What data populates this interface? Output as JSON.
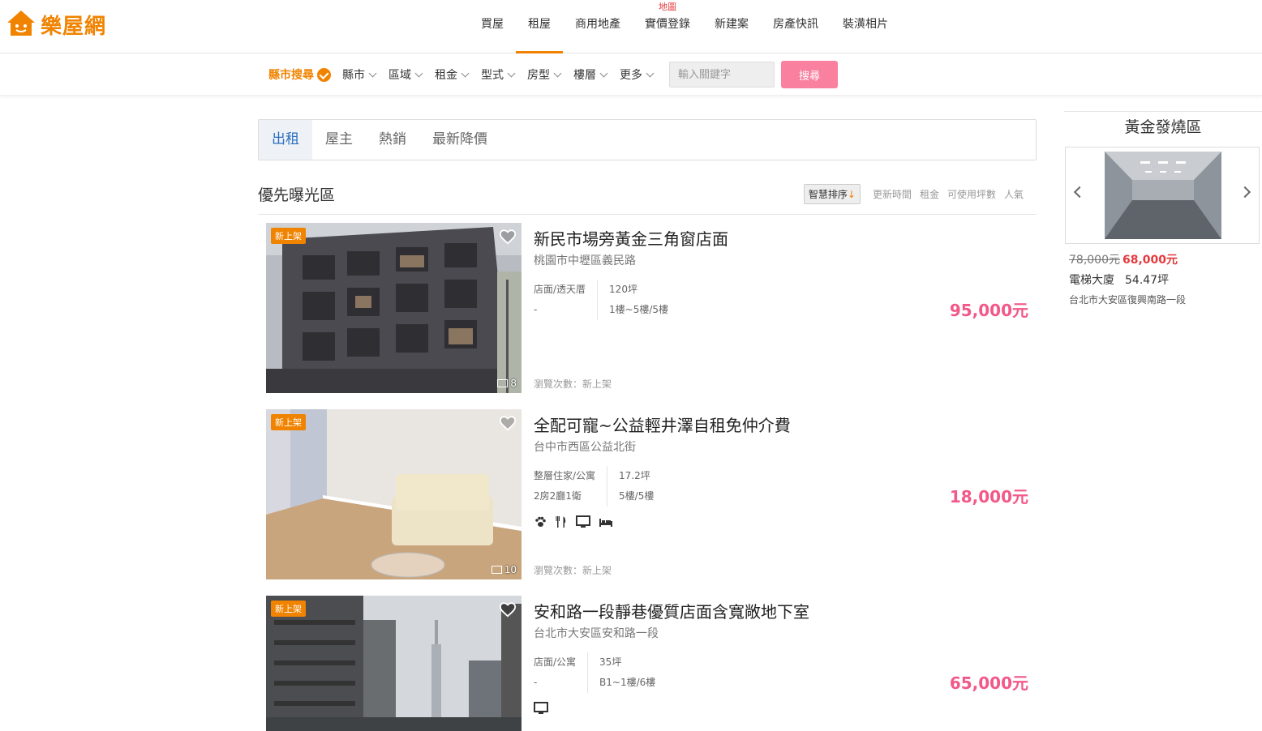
{
  "brand": {
    "name": "樂屋網",
    "color": "#f08300"
  },
  "nav": {
    "items": [
      {
        "label": "買屋"
      },
      {
        "label": "租屋",
        "active": true
      },
      {
        "label": "商用地產"
      },
      {
        "label": "實價登錄",
        "badge": "地圖"
      },
      {
        "label": "新建案"
      },
      {
        "label": "房產快訊"
      },
      {
        "label": "裝潢相片"
      }
    ]
  },
  "filters": {
    "city_search": "縣市搜尋",
    "dropdowns": [
      "縣市",
      "區域",
      "租金",
      "型式",
      "房型",
      "樓層",
      "更多"
    ],
    "keyword_placeholder": "輸入關鍵字",
    "search_label": "搜尋"
  },
  "tabs": [
    "出租",
    "屋主",
    "熱銷",
    "最新降價"
  ],
  "section": {
    "title": "優先曝光區",
    "sort_active": "智慧排序",
    "sort_options": [
      "更新時間",
      "租金",
      "可使用坪數",
      "人氣"
    ]
  },
  "listings": [
    {
      "tag": "新上架",
      "title": "新民市場旁黃金三角窗店面",
      "address": "桃園市中壢區義民路",
      "type": "店面/透天厝",
      "rooms": "-",
      "area": "120坪",
      "floor": "1樓~5樓/5樓",
      "price": "95,000元",
      "photos": "8",
      "views": "瀏覽次數：新上架",
      "amenities": []
    },
    {
      "tag": "新上架",
      "title": "全配可寵~公益輕井澤自租免仲介費",
      "address": "台中市西區公益北街",
      "type": "整層住家/公寓",
      "rooms": "2房2廳1衛",
      "area": "17.2坪",
      "floor": "5樓/5樓",
      "price": "18,000元",
      "photos": "10",
      "views": "瀏覽次數：新上架",
      "amenities": [
        "paw-icon",
        "utensils-icon",
        "tv-icon",
        "bed-icon"
      ]
    },
    {
      "tag": "新上架",
      "title": "安和路一段靜巷優質店面含寬敞地下室",
      "address": "台北市大安區安和路一段",
      "type": "店面/公寓",
      "rooms": "-",
      "area": "35坪",
      "floor": "B1~1樓/6樓",
      "price": "65,000元",
      "photos": "",
      "views": "",
      "amenities": [
        "tv-icon"
      ]
    }
  ],
  "sidebar": {
    "title": "黃金發燒區",
    "old_price": "78,000元",
    "new_price": "68,000元",
    "type": "電梯大廈",
    "area": "54.47坪",
    "address": "台北市大安區復興南路一段"
  },
  "colors": {
    "accent": "#f08300",
    "price": "#f25889",
    "tab_active": "#2a6ebb",
    "search_button": "#f9819f"
  }
}
